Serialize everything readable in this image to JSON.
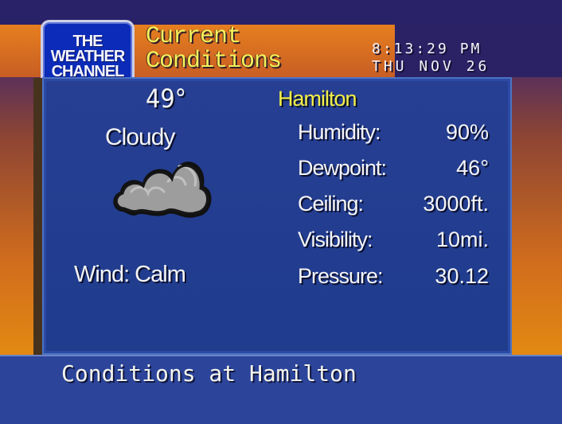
{
  "header": {
    "logo_text": "THE\nWEATHER\nCHANNEL",
    "title": "Current\nConditions",
    "time": "8:13:29 PM",
    "date": "THU NOV 26"
  },
  "current": {
    "temperature": "49°",
    "condition": "Cloudy",
    "wind": "Wind: Calm",
    "location": "Hamilton",
    "icon": "cloud-icon"
  },
  "stats": {
    "humidity_label": "Humidity:",
    "humidity_value": "90%",
    "dewpoint_label": "Dewpoint:",
    "dewpoint_value": "46°",
    "ceiling_label": "Ceiling:",
    "ceiling_value": "3000ft.",
    "visibility_label": "Visibility:",
    "visibility_value": "10mi.",
    "pressure_label": "Pressure:",
    "pressure_value": "30.12"
  },
  "bottom": {
    "text": "Conditions at Hamilton"
  },
  "colors": {
    "title": "#f4f15b",
    "location": "#f4ef47",
    "panel": "#273f93",
    "accent_orange": "#e38a12",
    "bottom_bar": "#2c459a"
  }
}
